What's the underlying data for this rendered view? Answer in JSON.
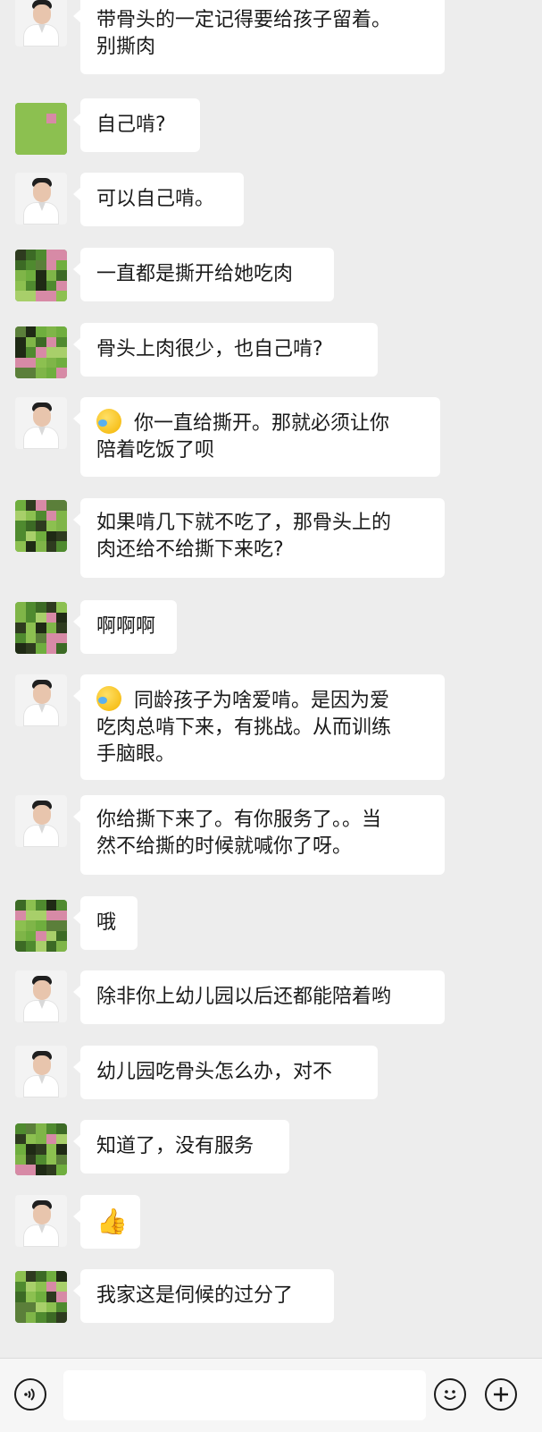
{
  "messages": [
    {
      "sender": "teacher",
      "text": "带骨头的一定记得要给孩子留着。\n别撕肉"
    },
    {
      "sender": "parent",
      "text": "自己啃?"
    },
    {
      "sender": "teacher",
      "text": "可以自己啃。"
    },
    {
      "sender": "parent",
      "text": "一直都是撕开给她吃肉"
    },
    {
      "sender": "parent",
      "text": "骨头上肉很少，也自己啃?"
    },
    {
      "sender": "teacher",
      "emoji": "face-with-tears-of-joy",
      "text": "你一直给撕开。那就必须让你\n陪着吃饭了呗"
    },
    {
      "sender": "parent",
      "text": "如果啃几下就不吃了，那骨头上的\n肉还给不给撕下来吃?"
    },
    {
      "sender": "parent",
      "text": "啊啊啊"
    },
    {
      "sender": "teacher",
      "emoji": "face-with-tears-of-joy",
      "text": "同龄孩子为啥爱啃。是因为爱\n吃肉总啃下来，有挑战。从而训练\n手脑眼。"
    },
    {
      "sender": "teacher",
      "text": "你给撕下来了。有你服务了。。当\n然不给撕的时候就喊你了呀。"
    },
    {
      "sender": "parent",
      "text": "哦"
    },
    {
      "sender": "teacher",
      "text": "除非你上幼儿园以后还都能陪着哟"
    },
    {
      "sender": "teacher",
      "text": "幼儿园吃骨头怎么办，对不"
    },
    {
      "sender": "parent",
      "text": "知道了，没有服务"
    },
    {
      "sender": "teacher",
      "text": "👍"
    },
    {
      "sender": "parent",
      "text": "我家这是伺候的过分了"
    }
  ],
  "input_bar": {
    "voice_icon": "voice-icon",
    "emoji_icon": "emoji-icon",
    "plus_icon": "plus-icon",
    "placeholder": ""
  },
  "colors": {
    "background": "#ededed",
    "bubble": "#ffffff",
    "input_bar": "#f6f6f6"
  }
}
